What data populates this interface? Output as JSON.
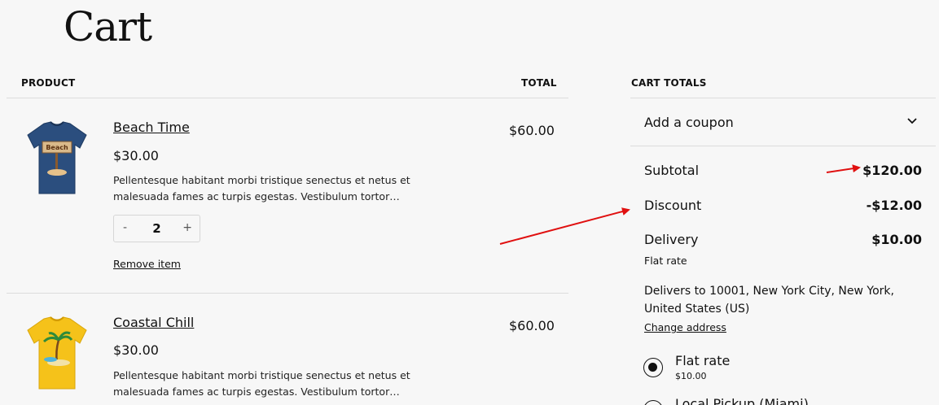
{
  "page": {
    "title": "Cart"
  },
  "table": {
    "product_header": "PRODUCT",
    "total_header": "TOTAL"
  },
  "items": [
    {
      "name": "Beach Time",
      "price": "$30.00",
      "description": "Pellentesque habitant morbi tristique senectus et netus et malesuada fames ac turpis egestas. Vestibulum tortor…",
      "quantity": "2",
      "qty_minus": "-",
      "qty_plus": "+",
      "remove_label": "Remove item",
      "line_total": "$60.00",
      "shirt_color": "#2b4e7e",
      "sign_text": "Beach"
    },
    {
      "name": "Coastal Chill",
      "price": "$30.00",
      "description": "Pellentesque habitant morbi tristique senectus et netus et malesuada fames ac turpis egestas. Vestibulum tortor…",
      "line_total": "$60.00",
      "shirt_color": "#f5c21a"
    }
  ],
  "totals": {
    "header": "CART TOTALS",
    "coupon_label": "Add a coupon",
    "subtotal_label": "Subtotal",
    "subtotal_value": "$120.00",
    "discount_label": "Discount",
    "discount_value": "-$12.00",
    "delivery_label": "Delivery",
    "delivery_value": "$10.00",
    "delivery_method": "Flat rate",
    "delivers_to": "Delivers to 10001, New York City, New York, United States (US)",
    "change_address": "Change address",
    "shipping_options": [
      {
        "label": "Flat rate",
        "price": "$10.00",
        "selected": true
      },
      {
        "label": "Local Pickup (Miami)",
        "selected": false
      }
    ]
  },
  "colors": {
    "annotation_arrow": "#e01010",
    "background": "#f7f7f7"
  }
}
